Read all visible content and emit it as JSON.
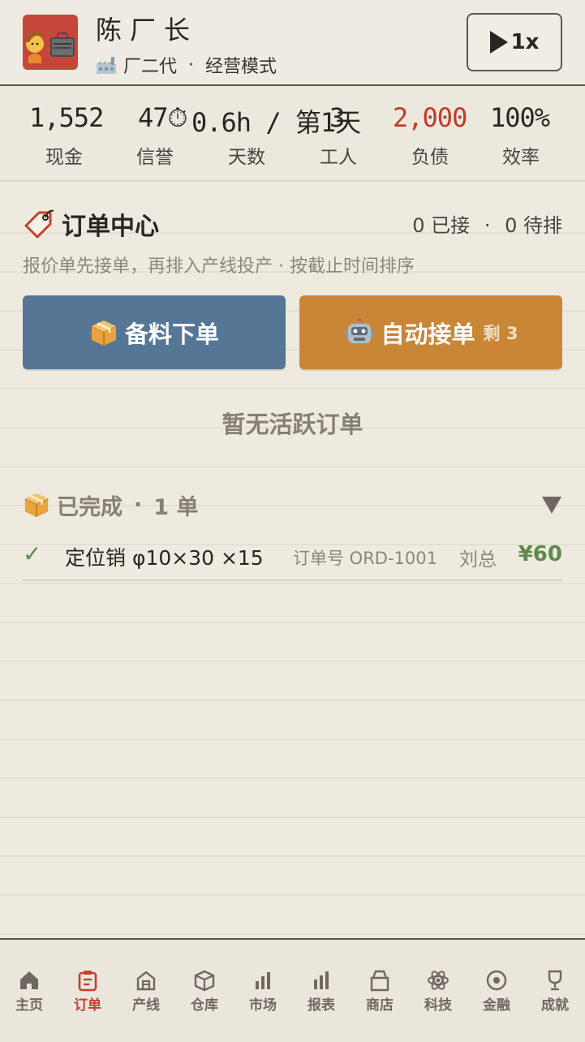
{
  "header": {
    "player_name": "陈厂长",
    "background": "厂二代",
    "mode": "经营模式",
    "separator": "·",
    "speed_label": "1x"
  },
  "stats": [
    {
      "value": "1,552",
      "label": "现金",
      "color": "#2a2520"
    },
    {
      "value": "47⏱",
      "label": "信誉",
      "color": "#2a2520"
    },
    {
      "value": "0.6h / 第1天",
      "label": "天数",
      "color": "#2a2520"
    },
    {
      "value": "3",
      "label": "工人",
      "color": "#2a2520"
    },
    {
      "value": "2,000",
      "label": "负债",
      "color": "#c0392b"
    },
    {
      "value": "100%",
      "label": "效率",
      "color": "#2a2520"
    }
  ],
  "orders": {
    "title": "订单中心",
    "accepted_count": "0 已接",
    "pending_count": "0 待排",
    "description": "报价单先接单，再排入产线投产 · 按截止时间排序",
    "stock_button": "备料下单",
    "auto_button": "自动接单",
    "auto_remaining": "剩 3",
    "empty_text": "暂无活跃订单",
    "completed_label": "已完成",
    "completed_count": "1 单",
    "completed_items": [
      {
        "part": "定位销 φ10×30 ×15",
        "order_no": "订单号 ORD-1001",
        "customer": "刘总",
        "price": "¥60"
      }
    ]
  },
  "tabs": [
    {
      "label": "主页",
      "icon": "home-icon",
      "active": false
    },
    {
      "label": "订单",
      "icon": "clipboard-icon",
      "active": true
    },
    {
      "label": "产线",
      "icon": "factory-icon",
      "active": false
    },
    {
      "label": "仓库",
      "icon": "box-icon",
      "active": false
    },
    {
      "label": "市场",
      "icon": "bar-chart-icon",
      "active": false
    },
    {
      "label": "报表",
      "icon": "report-icon",
      "active": false
    },
    {
      "label": "商店",
      "icon": "bag-icon",
      "active": false
    },
    {
      "label": "科技",
      "icon": "atom-icon",
      "active": false
    },
    {
      "label": "金融",
      "icon": "coin-icon",
      "active": false
    },
    {
      "label": "成就",
      "icon": "trophy-icon",
      "active": false
    }
  ],
  "colors": {
    "accent_red": "#c2402f",
    "button_blue": "#557695",
    "button_orange": "#c98637",
    "success_green": "#5f8a4a"
  }
}
